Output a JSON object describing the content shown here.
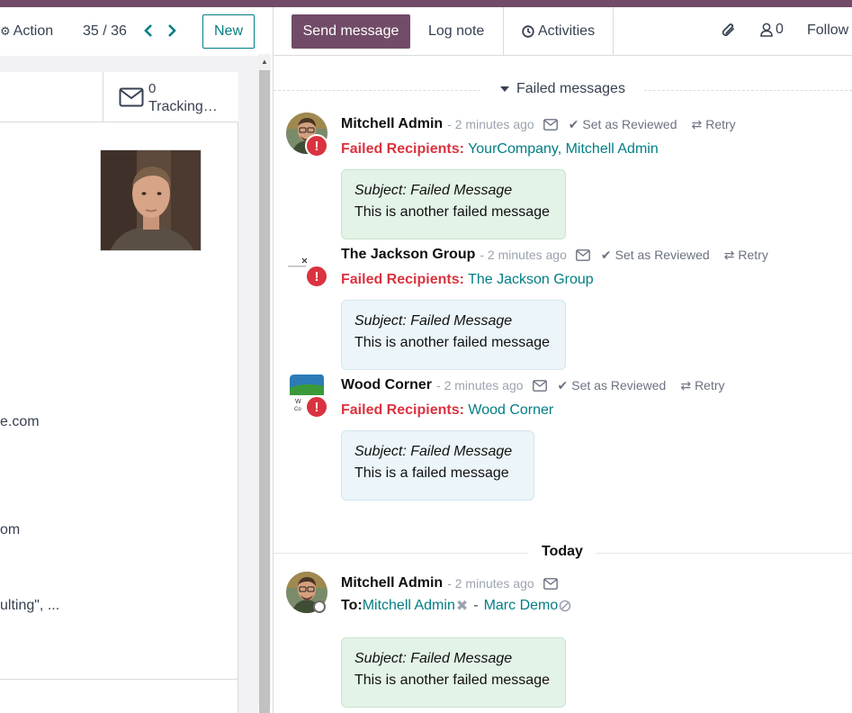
{
  "control_panel": {
    "action_label": "Action",
    "pager": "35 / 36",
    "new_label": "New"
  },
  "form": {
    "smart_button": {
      "count": "0",
      "label": "Tracking…"
    },
    "fragments": [
      "e.com",
      "om",
      "ulting\", ..."
    ]
  },
  "chatter": {
    "send_message": "Send message",
    "log_note": "Log note",
    "activities": "Activities",
    "followers_count": "0",
    "follow": "Follow",
    "failed_section": "Failed messages",
    "today_section": "Today",
    "set_as_reviewed": "Set as Reviewed",
    "retry": "Retry",
    "failed_label": "Failed Recipients:",
    "messages": [
      {
        "author": "Mitchell Admin",
        "when": "- 2 minutes ago",
        "recipients": "YourCompany, Mitchell Admin",
        "subject": "Subject: Failed Message",
        "body": "This is another failed message"
      },
      {
        "author": "The Jackson Group",
        "when": "- 2 minutes ago",
        "recipients": "The Jackson Group",
        "subject": "Subject: Failed Message",
        "body": "This is another failed message"
      },
      {
        "author": "Wood Corner",
        "when": "- 2 minutes ago",
        "recipients": "Wood Corner",
        "subject": "Subject: Failed Message",
        "body": "This is a failed message"
      }
    ],
    "today_message": {
      "author": "Mitchell Admin",
      "when": "- 2 minutes ago",
      "to_label": "To:",
      "to_recipient_1": "Mitchell Admin",
      "to_recipient_2": "Marc Demo",
      "subject": "Subject: Failed Message",
      "body": "This is another failed message"
    }
  },
  "colors": {
    "brand": "#714B67",
    "link": "#017e84",
    "danger": "#d9333f"
  }
}
